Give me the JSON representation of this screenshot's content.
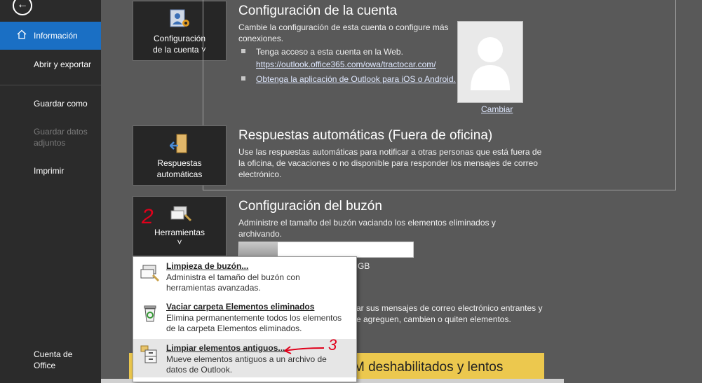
{
  "sidebar": {
    "back_icon": "arrow-left-icon",
    "items": [
      {
        "label": "Información",
        "active": true
      },
      {
        "label": "Abrir y exportar"
      },
      {
        "label": "Guardar como"
      },
      {
        "label": "Guardar datos adjuntos",
        "disabled": true
      },
      {
        "label": "Imprimir"
      },
      {
        "label": "Cuenta de Office"
      }
    ]
  },
  "account": {
    "tile_label_line1": "Configuración",
    "tile_label_line2": "de la cuenta ˅",
    "title": "Configuración de la cuenta",
    "desc": "Cambie la configuración de esta cuenta o configure más conexiones.",
    "bullet1_text": "Tenga acceso a esta cuenta en la Web.",
    "bullet1_link": "https://outlook.office365.com/owa/tractocar.com/",
    "bullet2_link": "Obtenga la aplicación de Outlook para iOS o Android.",
    "avatar_link": "Cambiar"
  },
  "autoreply": {
    "tile_label_line1": "Respuestas",
    "tile_label_line2": "automáticas",
    "title": "Respuestas automáticas (Fuera de oficina)",
    "desc": "Use las respuestas automáticas para notificar a otras personas que está fuera de la oficina, de vacaciones o no disponible para responder los mensajes de correo electrónico."
  },
  "mailbox": {
    "tile_label": "Herramientas",
    "tile_chevron": "˅",
    "annotation_2": "2",
    "title": "Configuración del buzón",
    "desc": "Administre el tamaño del buzón vaciando los elementos eliminados y archivando.",
    "progress_fraction": 0.22,
    "size_suffix": "GB"
  },
  "rules": {
    "desc_line1": "ar sus mensajes de correo electrónico entrantes y",
    "desc_line2": "e agreguen, cambien o quiten elementos."
  },
  "banner": {
    "title": "M deshabilitados y lentos"
  },
  "dropdown": {
    "items": [
      {
        "title": "Limpieza de buzón...",
        "desc": "Administra el tamaño del buzón con herramientas avanzadas."
      },
      {
        "title": "Vaciar carpeta Elementos eliminados",
        "desc": "Elimina permanentemente todos los elementos de la carpeta Elementos eliminados."
      },
      {
        "title": "Limpiar elementos antiguos...",
        "desc": "Mueve elementos antiguos a un archivo de datos de Outlook."
      }
    ],
    "annotation_3": "3"
  },
  "colors": {
    "accent": "#1a6fc4",
    "annotation": "#e0001b",
    "banner": "#ecc84e"
  }
}
